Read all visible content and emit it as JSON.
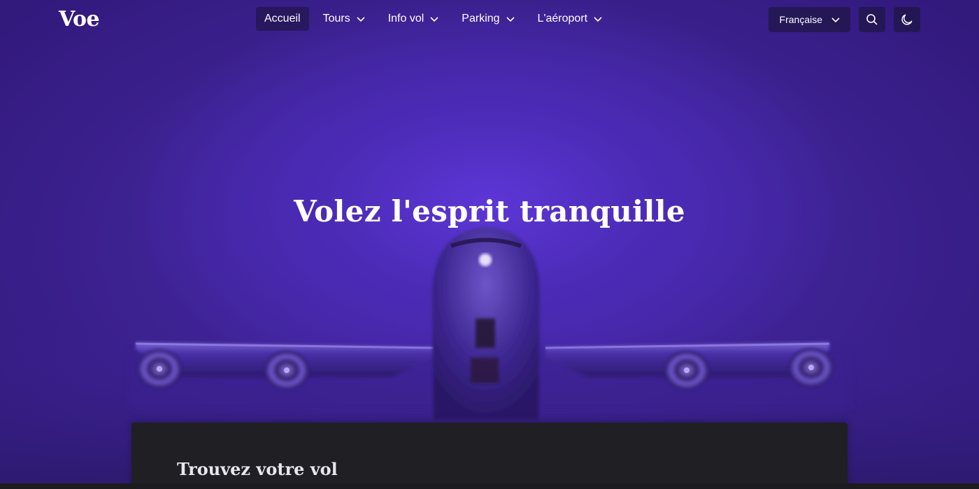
{
  "brand": {
    "logo": "Voe"
  },
  "nav": {
    "items": [
      {
        "label": "Accueil",
        "active": true,
        "has_dropdown": false
      },
      {
        "label": "Tours",
        "active": false,
        "has_dropdown": true
      },
      {
        "label": "Info vol",
        "active": false,
        "has_dropdown": true
      },
      {
        "label": "Parking",
        "active": false,
        "has_dropdown": true
      },
      {
        "label": "L'aéroport",
        "active": false,
        "has_dropdown": true
      }
    ],
    "language": {
      "selected": "Française",
      "icon": "chevron-down-icon"
    },
    "search_icon": "search-icon",
    "theme_icon": "moon-icon"
  },
  "hero": {
    "title": "Volez l'esprit tranquille"
  },
  "search_card": {
    "title": "Trouvez votre vol"
  },
  "colors": {
    "hero_purple": "#4b2bb6",
    "hero_dark": "#32197c",
    "card_bg": "#201f23",
    "page_bg": "#1c1b1f"
  }
}
